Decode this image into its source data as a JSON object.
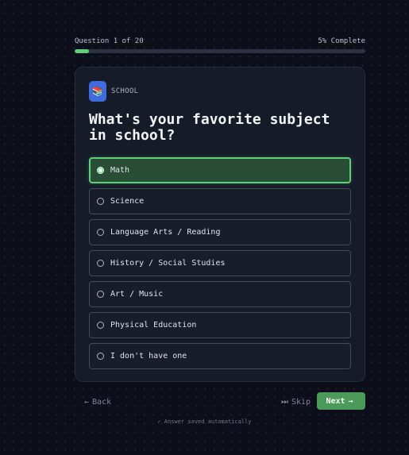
{
  "progress": {
    "question_label": "Question 1 of 20",
    "complete_label": "5% Complete",
    "fraction": 0.05,
    "accent": "#5fd07a"
  },
  "card": {
    "category_icon": "books-emoji-icon",
    "category_emoji": "📚",
    "category_label": "SCHOOL",
    "question": "What's your favorite subject in school?",
    "options": [
      {
        "label": "Math",
        "selected": true
      },
      {
        "label": "Science",
        "selected": false
      },
      {
        "label": "Language Arts / Reading",
        "selected": false
      },
      {
        "label": "History / Social Studies",
        "selected": false
      },
      {
        "label": "Art / Music",
        "selected": false
      },
      {
        "label": "Physical Education",
        "selected": false
      },
      {
        "label": "I don't have one",
        "selected": false
      }
    ]
  },
  "nav": {
    "back_icon": "←",
    "back_label": "Back",
    "skip_icon": "⏭",
    "skip_label": "Skip",
    "next_label": "Next",
    "next_icon": "→",
    "next_color": "#4c9a59"
  },
  "footer": {
    "saved_note": "✓ Answer saved automatically"
  }
}
